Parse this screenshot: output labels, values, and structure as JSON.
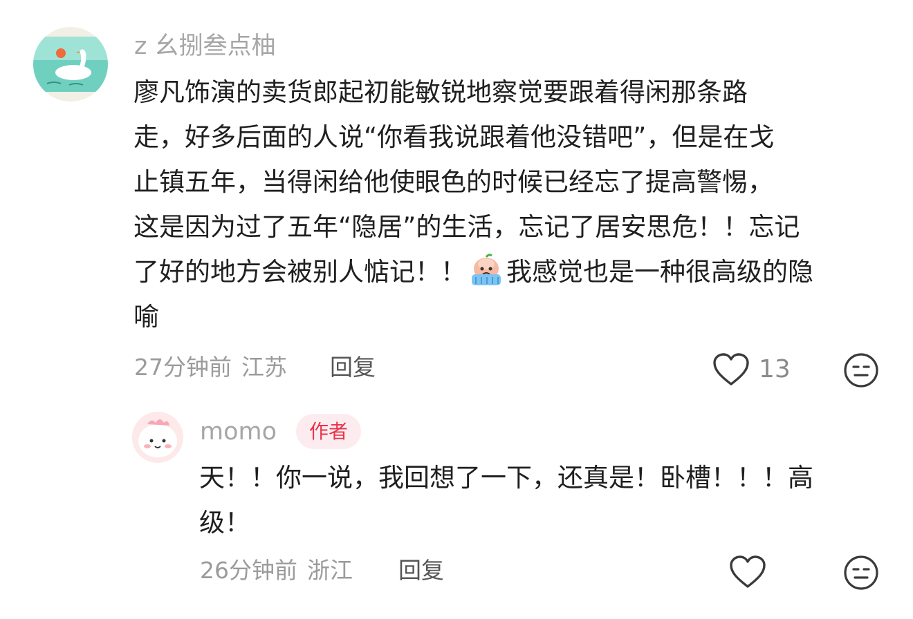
{
  "comment": {
    "username": "z 幺捌叁点柚",
    "body_lines": [
      "廖凡饰演的卖货郎起初能敏锐地察觉要跟着得闲那条路",
      "走，好多后面的人说“你看我说跟着他没错吧”，但是在戈",
      "止镇五年，当得闲给他使眼色的时候已经忘了提高警惕，",
      "这是因为过了五年“隐居”的生活，忘记了居安思危！！忘记"
    ],
    "line5_before_emoji": "了好的地方会被别人惦记！！",
    "emoji_name": "crying-peach-emoji",
    "line5_after_emoji": "我感觉也是一种很高级的隐",
    "line6": "喻",
    "time": "27分钟前",
    "location": "江苏",
    "reply_label": "回复",
    "like_count": "13"
  },
  "reply": {
    "username": "momo",
    "badge": "作者",
    "body_lines": [
      "天！！你一说，我回想了一下，还真是！卧槽！！！高",
      "级！"
    ],
    "time": "26分钟前",
    "location": "浙江",
    "reply_label": "回复"
  },
  "icons": {
    "like": "heart-outline-icon",
    "dislike": "neutral-face-icon"
  },
  "colors": {
    "username": "#a6a6a6",
    "body": "#1f1f1f",
    "meta": "#9b9b9b",
    "badge_text": "#e8334a",
    "badge_bg": "#fdecef"
  }
}
